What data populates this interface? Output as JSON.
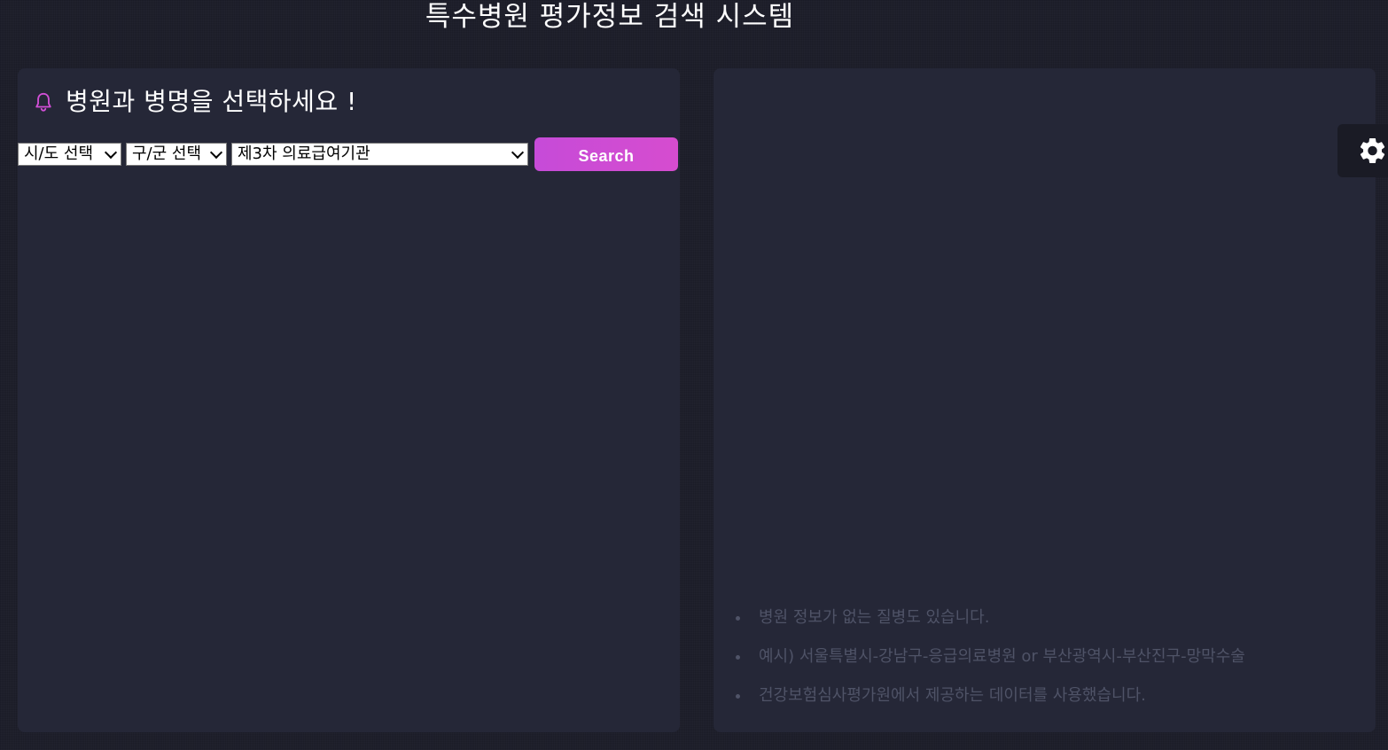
{
  "header": {
    "title": "특수병원 평가정보 검색 시스템"
  },
  "left_panel": {
    "heading": "병원과 병명을 선택하세요 !",
    "icon": "bell-icon",
    "filters": {
      "sido": {
        "selected": "시/도 선택"
      },
      "gugun": {
        "selected": "구/군 선택"
      },
      "type": {
        "selected": "제3차 의료급여기관"
      }
    },
    "search_label": "Search"
  },
  "right_panel": {
    "notes": [
      "병원 정보가 없는 질병도 있습니다.",
      "예시) 서울특별시-강남구-응급의료병원 or 부산광역시-부산진구-망막수술",
      "건강보험심사평가원에서 제공하는 데이터를 사용했습니다."
    ]
  },
  "settings": {
    "icon": "gear-icon"
  },
  "colors": {
    "background": "#1e1f2b",
    "panel": "#252737",
    "accent": "#cf4bd6",
    "muted_text": "#4f5367"
  }
}
